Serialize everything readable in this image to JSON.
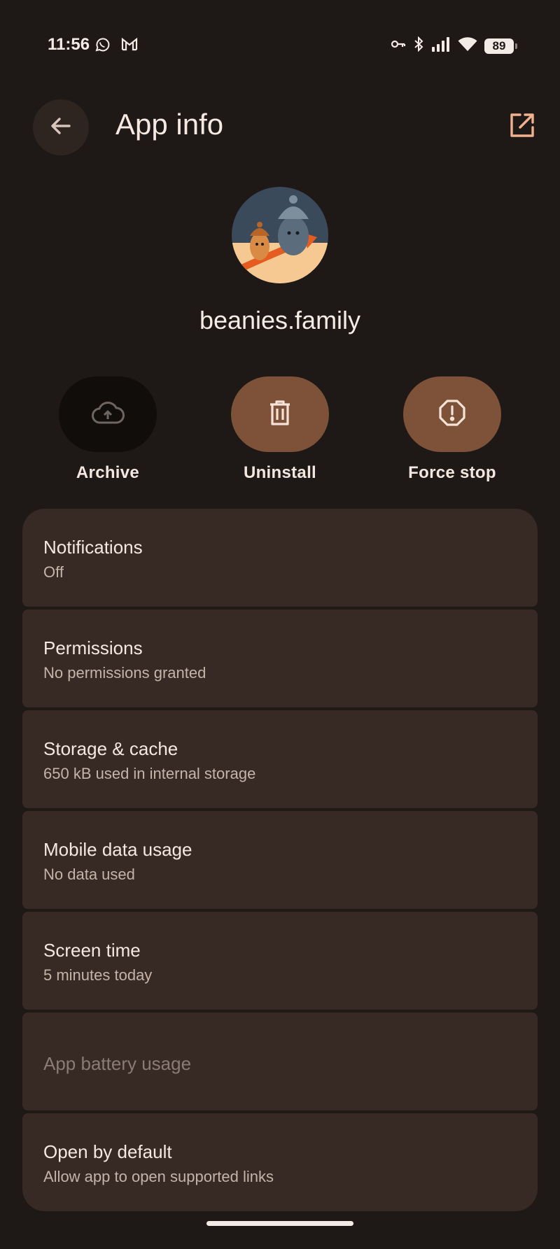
{
  "status_bar": {
    "time": "11:56",
    "battery": "89",
    "left_icons": [
      "whatsapp-icon",
      "gmail-icon"
    ],
    "right_icons": [
      "vpn-key-icon",
      "bluetooth-icon",
      "signal-icon",
      "wifi-icon",
      "battery-icon"
    ]
  },
  "header": {
    "title": "App info",
    "back_icon": "arrow-back-icon",
    "open_icon": "open-in-new-icon"
  },
  "app": {
    "name": "beanies.family"
  },
  "actions": [
    {
      "label": "Archive",
      "icon": "cloud-upload-icon",
      "enabled": false
    },
    {
      "label": "Uninstall",
      "icon": "trash-icon",
      "enabled": true
    },
    {
      "label": "Force stop",
      "icon": "alert-octagon-icon",
      "enabled": true
    }
  ],
  "settings": [
    {
      "title": "Notifications",
      "subtitle": "Off"
    },
    {
      "title": "Permissions",
      "subtitle": "No permissions granted"
    },
    {
      "title": "Storage & cache",
      "subtitle": "650 kB used in internal storage"
    },
    {
      "title": "Mobile data usage",
      "subtitle": "No data used"
    },
    {
      "title": "Screen time",
      "subtitle": "5 minutes today"
    },
    {
      "title": "App battery usage",
      "subtitle": ""
    },
    {
      "title": "Open by default",
      "subtitle": "Allow app to open supported links"
    }
  ],
  "colors": {
    "background": "#1e1917",
    "card": "#372923",
    "accent": "#7e5238",
    "accent_icon": "#f0b28e"
  }
}
